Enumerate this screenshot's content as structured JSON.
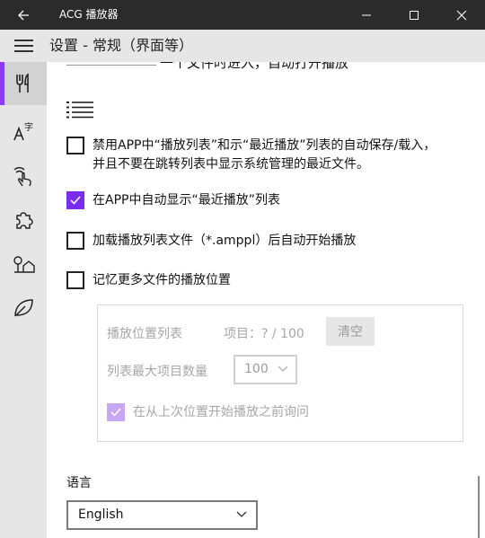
{
  "window": {
    "title": "ACG 播放器",
    "back_icon": "arrow-left-icon",
    "minimize_icon": "minimize-icon",
    "maximize_icon": "maximize-icon",
    "close_icon": "close-icon"
  },
  "header": {
    "title": "设置 - 常规（界面等）",
    "menu_icon": "hamburger-menu-icon"
  },
  "sidebar": {
    "accent": "#8a3cf5",
    "items": [
      {
        "icon": "utensils-icon",
        "active": true
      },
      {
        "icon": "font-size-icon",
        "active": false
      },
      {
        "icon": "touch-gesture-icon",
        "active": false
      },
      {
        "icon": "puzzle-icon",
        "active": false
      },
      {
        "icon": "tree-house-icon",
        "active": false
      },
      {
        "icon": "leaf-icon",
        "active": false
      }
    ]
  },
  "main": {
    "cut_off_text": "一个文件时进入，自动打开播放",
    "list_icon": "list-icon",
    "options": [
      {
        "label": "禁用APP中“播放列表”和示“最近播放”列表的自动保存/载入，并且不要在跳转列表中显示系统管理的最近文件。",
        "checked": false
      },
      {
        "label": "在APP中自动显示“最近播放”列表",
        "checked": true
      },
      {
        "label": "加载播放列表文件（*.amppl）后自动开始播放",
        "checked": false
      },
      {
        "label": "记忆更多文件的播放位置",
        "checked": false
      }
    ],
    "group": {
      "list_label": "播放位置列表",
      "items_label": "项目：? / 100",
      "clear_button": "清空",
      "max_label": "列表最大项目数量",
      "max_value": "100",
      "ask_label": "在从上次位置开始播放之前询问",
      "ask_checked": true
    },
    "language": {
      "label": "语言",
      "value": "English"
    }
  }
}
